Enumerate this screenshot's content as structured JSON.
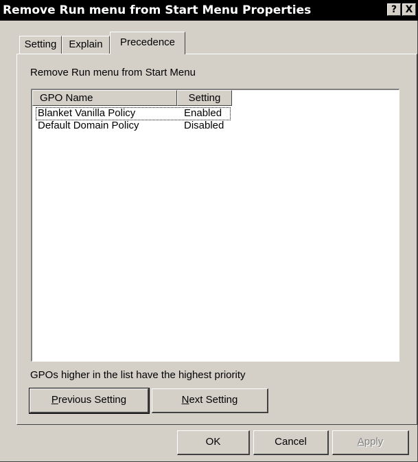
{
  "window": {
    "title": "Remove Run menu from Start Menu Properties",
    "help_label": "?",
    "close_label": "X"
  },
  "tabs": [
    {
      "label": "Setting",
      "active": false
    },
    {
      "label": "Explain",
      "active": false
    },
    {
      "label": "Precedence",
      "active": true
    }
  ],
  "policy_name": "Remove Run menu from Start Menu",
  "list": {
    "columns": [
      "GPO Name",
      "Setting"
    ],
    "rows": [
      {
        "name": "Blanket Vanilla Policy",
        "setting": "Enabled",
        "focused": true
      },
      {
        "name": "Default Domain Policy",
        "setting": "Disabled",
        "focused": false
      }
    ]
  },
  "footnote": "GPOs higher in the list have the highest priority",
  "nav_buttons": {
    "previous": {
      "mnemonic": "P",
      "rest": "revious Setting"
    },
    "next": {
      "mnemonic": "N",
      "rest": "ext Setting"
    }
  },
  "dialog_buttons": {
    "ok": "OK",
    "cancel": "Cancel",
    "apply": {
      "mnemonic": "A",
      "rest": "pply",
      "disabled": true
    }
  }
}
